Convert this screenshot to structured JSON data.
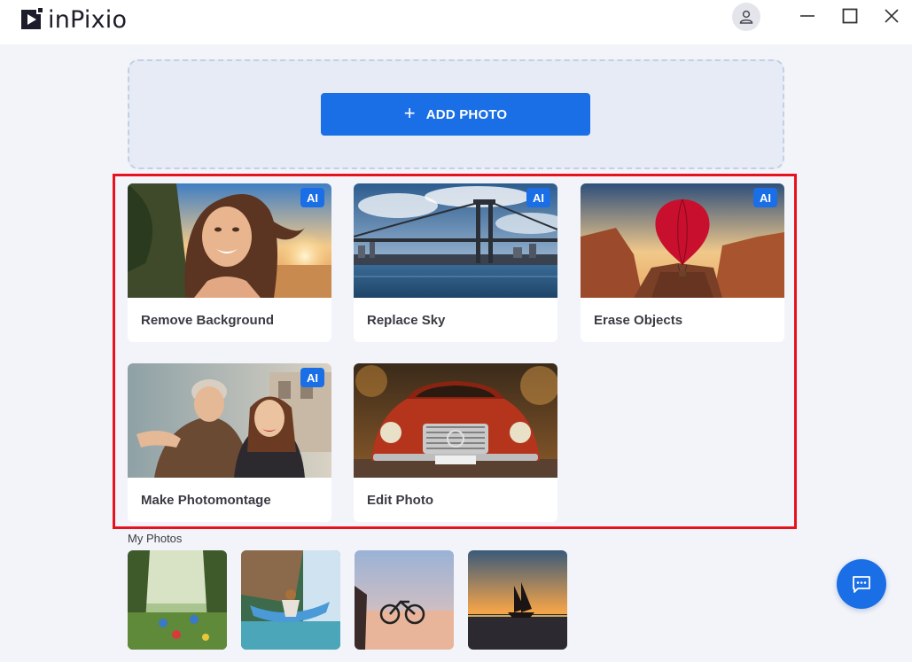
{
  "app": {
    "name": "inPixio"
  },
  "colors": {
    "accent": "#1a6ee6",
    "highlight": "#e8121e",
    "background": "#f2f4f9"
  },
  "titlebar": {
    "icons": [
      "user-icon",
      "minimize-icon",
      "maximize-icon",
      "close-icon"
    ]
  },
  "dropzone": {
    "add_photo_label": "ADD PHOTO",
    "plus": "+"
  },
  "features": [
    {
      "label": "Remove Background",
      "badge": "AI"
    },
    {
      "label": "Replace Sky",
      "badge": "AI"
    },
    {
      "label": "Erase Objects",
      "badge": "AI"
    },
    {
      "label": "Make Photomontage",
      "badge": "AI"
    },
    {
      "label": "Edit Photo"
    }
  ],
  "my_photos": {
    "title": "My Photos",
    "count": 4
  },
  "chat": {
    "icon": "chat-icon"
  }
}
